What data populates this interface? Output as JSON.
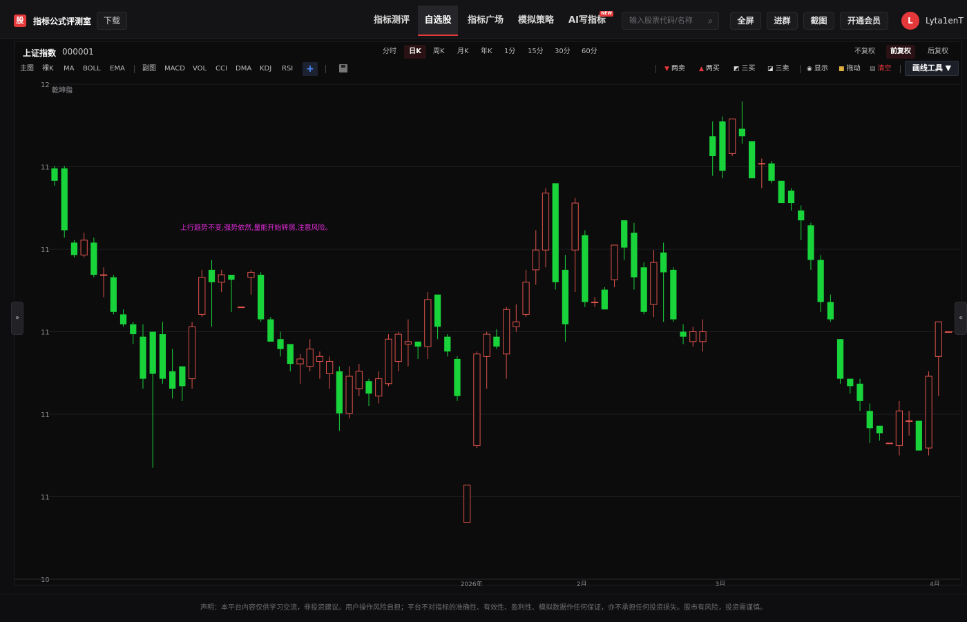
{
  "header": {
    "logo_text": "股",
    "app_title": "指标公式评测室",
    "download_label": "下载",
    "nav": [
      {
        "label": "指标测评"
      },
      {
        "label": "自选股"
      },
      {
        "label": "指标广场"
      },
      {
        "label": "模拟策略"
      },
      {
        "label": "AI写指标",
        "badge": "NEW"
      }
    ],
    "search_placeholder": "输入股票代码/名称",
    "buttons": {
      "fullscreen": "全屏",
      "join_group": "进群",
      "screenshot": "截图",
      "vip": "开通会员"
    },
    "user": {
      "avatar_letter": "L",
      "name": "Lyta1enT"
    }
  },
  "symbol": {
    "name": "上证指数",
    "code": "000001"
  },
  "periods": [
    "分时",
    "日K",
    "周K",
    "月K",
    "年K",
    "1分",
    "15分",
    "30分",
    "60分"
  ],
  "active_period": "日K",
  "adjustments": [
    "不复权",
    "前复权",
    "后复权"
  ],
  "active_adjustment": "前复权",
  "indicators": {
    "main_label": "主图",
    "main": [
      "裸K",
      "MA",
      "BOLL",
      "EMA"
    ],
    "sub_label": "副图",
    "sub": [
      "MACD",
      "VOL",
      "CCI",
      "DMA",
      "KDJ",
      "RSI"
    ],
    "add_label": "+"
  },
  "signals": {
    "sell2": "两卖",
    "buy2": "两买",
    "buy3": "三买",
    "sell3": "三卖",
    "show": "显示",
    "drag": "拖动",
    "clear": "清空",
    "draw_tools": "画线工具 ▼"
  },
  "colors": {
    "up": "#e0534b",
    "down": "#19d33a",
    "annotation": "#e12bd8",
    "accent": "#e5383b"
  },
  "chart_data": {
    "type": "candlestick",
    "indicator_name": "乾坤指",
    "annotation": "上行趋势不变,强势依然,量能开始转弱,注意风险。",
    "y_tick_labels": [
      "12",
      "11",
      "11",
      "11",
      "11",
      "11",
      "10"
    ],
    "x_tick_labels": [
      "2026年",
      "2月",
      "3月",
      "4月"
    ],
    "ylim": [
      10.0,
      12.0
    ],
    "grid": true,
    "candles": [
      [
        11.66,
        11.61,
        11.67,
        11.59
      ],
      [
        11.66,
        11.41,
        11.67,
        11.38
      ],
      [
        11.36,
        11.31,
        11.37,
        11.3
      ],
      [
        11.31,
        11.37,
        11.4,
        11.3
      ],
      [
        11.36,
        11.23,
        11.38,
        11.22
      ],
      [
        11.23,
        11.23,
        11.26,
        11.14
      ],
      [
        11.22,
        11.08,
        11.23,
        11.07
      ],
      [
        11.07,
        11.03,
        11.09,
        11.02
      ],
      [
        11.03,
        10.99,
        11.04,
        10.95
      ],
      [
        10.98,
        10.81,
        11.03,
        10.77
      ],
      [
        11.0,
        10.83,
        11.0,
        10.45
      ],
      [
        10.99,
        10.81,
        11.04,
        10.79
      ],
      [
        10.84,
        10.77,
        10.93,
        10.73
      ],
      [
        10.86,
        10.78,
        10.86,
        10.72
      ],
      [
        10.81,
        11.02,
        11.04,
        10.77
      ],
      [
        11.07,
        11.22,
        11.25,
        11.06
      ],
      [
        11.25,
        11.2,
        11.29,
        11.02
      ],
      [
        11.2,
        11.23,
        11.25,
        11.16
      ],
      [
        11.23,
        11.21,
        11.23,
        11.08
      ],
      [
        11.1,
        11.1,
        11.1,
        11.1
      ],
      [
        11.22,
        11.24,
        11.25,
        11.15
      ],
      [
        11.23,
        11.05,
        11.24,
        11.04
      ],
      [
        11.05,
        10.96,
        11.06,
        10.96
      ],
      [
        10.97,
        10.93,
        11.0,
        10.9
      ],
      [
        10.95,
        10.87,
        10.95,
        10.84
      ],
      [
        10.87,
        10.89,
        10.91,
        10.79
      ],
      [
        10.86,
        10.93,
        10.97,
        10.84
      ],
      [
        10.88,
        10.9,
        10.92,
        10.81
      ],
      [
        10.83,
        10.88,
        10.9,
        10.77
      ],
      [
        10.84,
        10.67,
        10.86,
        10.6
      ],
      [
        10.67,
        10.82,
        10.86,
        10.65
      ],
      [
        10.77,
        10.84,
        10.87,
        10.74
      ],
      [
        10.8,
        10.75,
        10.81,
        10.7
      ],
      [
        10.74,
        10.81,
        10.84,
        10.71
      ],
      [
        10.79,
        10.97,
        10.99,
        10.78
      ],
      [
        10.88,
        10.99,
        11.0,
        10.84
      ],
      [
        10.95,
        10.96,
        11.05,
        10.86
      ],
      [
        10.96,
        10.94,
        10.96,
        10.89
      ],
      [
        10.94,
        11.13,
        11.16,
        10.89
      ],
      [
        11.15,
        11.02,
        11.15,
        10.97
      ],
      [
        10.98,
        10.92,
        10.99,
        10.9
      ],
      [
        10.89,
        10.74,
        10.9,
        10.72
      ],
      [
        10.23,
        10.38,
        10.38,
        10.23
      ],
      [
        10.54,
        10.91,
        10.92,
        10.53
      ],
      [
        10.9,
        10.99,
        11.0,
        10.77
      ],
      [
        10.98,
        10.94,
        11.01,
        10.93
      ],
      [
        10.91,
        11.09,
        11.1,
        10.81
      ],
      [
        11.02,
        11.04,
        11.11,
        11.0
      ],
      [
        11.07,
        11.2,
        11.25,
        11.06
      ],
      [
        11.25,
        11.33,
        11.41,
        11.19
      ],
      [
        11.33,
        11.56,
        11.58,
        11.26
      ],
      [
        11.6,
        11.2,
        11.6,
        11.17
      ],
      [
        11.25,
        11.03,
        11.31,
        10.96
      ],
      [
        11.33,
        11.52,
        11.54,
        11.16
      ],
      [
        11.39,
        11.12,
        11.41,
        11.1
      ],
      [
        11.12,
        11.12,
        11.14,
        11.1
      ],
      [
        11.17,
        11.09,
        11.18,
        11.09
      ],
      [
        11.21,
        11.35,
        11.34,
        11.18
      ],
      [
        11.45,
        11.34,
        11.45,
        11.29
      ],
      [
        11.4,
        11.22,
        11.44,
        11.17
      ],
      [
        11.26,
        11.08,
        11.28,
        11.07
      ],
      [
        11.11,
        11.28,
        11.33,
        11.06
      ],
      [
        11.32,
        11.24,
        11.36,
        11.04
      ],
      [
        11.25,
        11.05,
        11.26,
        11.04
      ],
      [
        11.0,
        10.98,
        11.03,
        10.95
      ],
      [
        10.96,
        11.0,
        11.02,
        10.94
      ],
      [
        10.96,
        11.0,
        11.05,
        10.92
      ],
      [
        11.79,
        11.71,
        11.85,
        11.63
      ],
      [
        11.85,
        11.65,
        11.87,
        11.62
      ],
      [
        11.72,
        11.86,
        11.85,
        11.71
      ],
      [
        11.82,
        11.79,
        11.93,
        11.76
      ],
      [
        11.77,
        11.62,
        11.77,
        11.63
      ],
      [
        11.68,
        11.68,
        11.7,
        11.58
      ],
      [
        11.68,
        11.61,
        11.69,
        11.6
      ],
      [
        11.61,
        11.52,
        11.61,
        11.53
      ],
      [
        11.57,
        11.52,
        11.58,
        11.49
      ],
      [
        11.49,
        11.45,
        11.51,
        11.37
      ],
      [
        11.43,
        11.29,
        11.44,
        11.25
      ],
      [
        11.29,
        11.12,
        11.31,
        11.08
      ],
      [
        11.12,
        11.05,
        11.15,
        11.04
      ],
      [
        10.97,
        10.81,
        10.97,
        10.79
      ],
      [
        10.81,
        10.78,
        10.8,
        10.75
      ],
      [
        10.79,
        10.72,
        10.81,
        10.68
      ],
      [
        10.68,
        10.61,
        10.71,
        10.55
      ],
      [
        10.62,
        10.59,
        10.61,
        10.56
      ],
      [
        10.55,
        10.55,
        10.55,
        10.55
      ],
      [
        10.54,
        10.68,
        10.72,
        10.5
      ],
      [
        10.64,
        10.64,
        10.68,
        10.58
      ],
      [
        10.64,
        10.52,
        10.64,
        10.52
      ],
      [
        10.53,
        10.82,
        10.84,
        10.5
      ],
      [
        10.9,
        11.04,
        11.03,
        10.74
      ],
      [
        11.0,
        11.0,
        11.0,
        11.0
      ]
    ]
  },
  "side_arrows": {
    "left": "»",
    "right": "«"
  },
  "disclaimer": "声明：本平台内容仅供学习交流，非投资建议。用户操作风险自担；平台不对指标的准确性、有效性、盈利性、模拟数据作任何保证，亦不承担任何投资损失。股市有风险，投资需谨慎。"
}
